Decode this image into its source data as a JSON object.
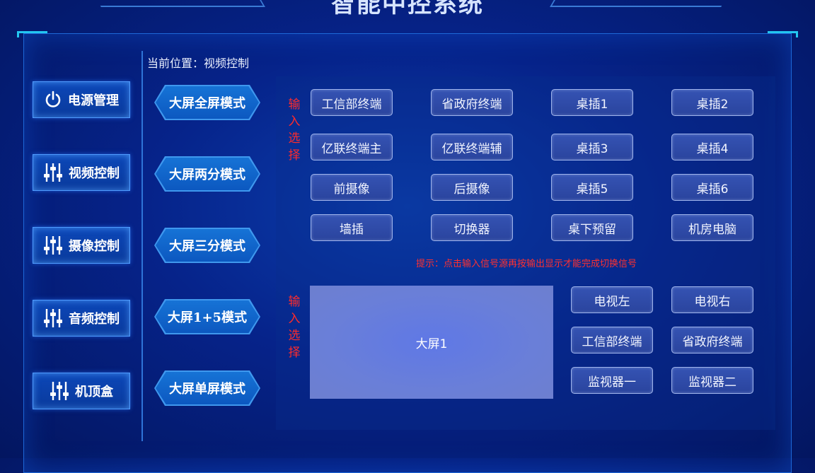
{
  "title": "智能中控系统",
  "breadcrumb": "当前位置：视频控制",
  "nav": [
    {
      "label": "电源管理",
      "icon": "power-icon"
    },
    {
      "label": "视频控制",
      "icon": "sliders-icon"
    },
    {
      "label": "摄像控制",
      "icon": "sliders-icon"
    },
    {
      "label": "音频控制",
      "icon": "sliders-icon"
    },
    {
      "label": "机顶盒",
      "icon": "sliders-icon"
    }
  ],
  "modes": [
    "大屏全屏模式",
    "大屏两分模式",
    "大屏三分模式",
    "大屏1+5模式",
    "大屏单屏模式"
  ],
  "input_label": "输入选择",
  "output_label": "输入选择",
  "inputs": [
    [
      "工信部终端",
      "省政府终端",
      "桌插1",
      "桌插2"
    ],
    [
      "亿联终端主",
      "亿联终端辅",
      "桌插3",
      "桌插4"
    ],
    [
      "前摄像",
      "后摄像",
      "桌插5",
      "桌插6"
    ],
    [
      "墙插",
      "切换器",
      "桌下预留",
      "机房电脑"
    ]
  ],
  "hint": "提示：点击输入信号源再按输出显示才能完成切换信号",
  "screen_label": "大屏1",
  "outputs": [
    [
      "电视左",
      "电视右"
    ],
    [
      "工信部终端",
      "省政府终端"
    ],
    [
      "监视器一",
      "监视器二"
    ]
  ],
  "colors": {
    "accent": "#23c6f0",
    "hint": "#ff3030",
    "background": "#06238a"
  }
}
